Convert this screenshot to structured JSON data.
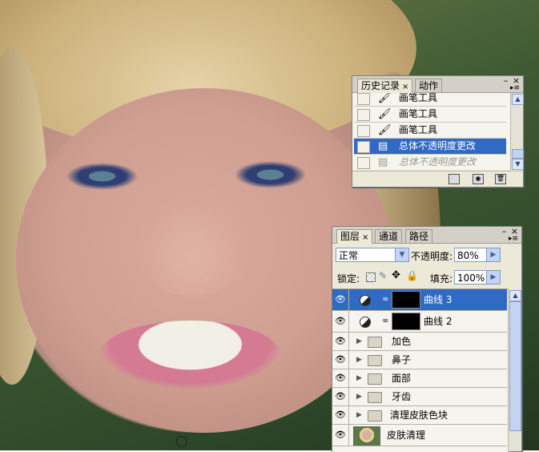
{
  "history_panel": {
    "tabs": [
      {
        "label": "历史记录",
        "close": "×"
      },
      {
        "label": "动作"
      }
    ],
    "items": [
      {
        "label": "画笔工具",
        "icon": "brush-icon"
      },
      {
        "label": "画笔工具",
        "icon": "brush-icon"
      },
      {
        "label": "画笔工具",
        "icon": "brush-icon"
      },
      {
        "label": "总体不透明度更改",
        "icon": "history-state-icon"
      },
      {
        "label": "总体不透明度更改",
        "icon": "history-state-icon"
      }
    ],
    "selected_index": 3
  },
  "layers_panel": {
    "tabs": [
      {
        "label": "图层",
        "close": "×"
      },
      {
        "label": "通道"
      },
      {
        "label": "路径"
      }
    ],
    "blend_mode": "正常",
    "opacity_label": "不透明度:",
    "opacity_value": "80%",
    "lock_label": "锁定:",
    "fill_label": "填充:",
    "fill_value": "100%",
    "layers": [
      {
        "name": "曲线 3",
        "type": "adjustment"
      },
      {
        "name": "曲线 2",
        "type": "adjustment"
      },
      {
        "name": "加色",
        "type": "group"
      },
      {
        "name": "鼻子",
        "type": "group"
      },
      {
        "name": "面部",
        "type": "group"
      },
      {
        "name": "牙齿",
        "type": "group"
      },
      {
        "name": "清理皮肤色块",
        "type": "group"
      },
      {
        "name": "皮肤清理",
        "type": "image"
      }
    ],
    "selected_index": 0
  },
  "glyphs": {
    "eye": "👁",
    "minimize": "–",
    "close": "×",
    "menu": "▸≡",
    "dropdown": "▼",
    "slider": "▶",
    "expand": "▶",
    "scroll_up": "▲",
    "scroll_down": "▼",
    "chain": "∞"
  },
  "colors": {
    "selection": "#316ac5",
    "panel_bg": "#ece9d8"
  }
}
